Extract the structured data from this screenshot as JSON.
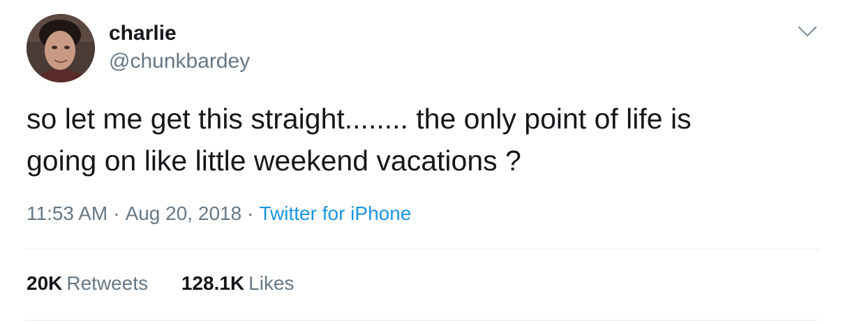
{
  "user": {
    "display_name": "charlie",
    "handle": "@chunkbardey"
  },
  "tweet": {
    "text_line1": "so let me get this straight........ the only point of life is",
    "text_line2": "going on like little weekend vacations ?",
    "time": "11:53 AM",
    "date": "Aug 20, 2018",
    "separator": "·",
    "source": "Twitter for iPhone"
  },
  "stats": {
    "retweets_count": "20K",
    "retweets_label": "Retweets",
    "likes_count": "128.1K",
    "likes_label": "Likes"
  },
  "icons": {
    "caret": "chevron-down-icon",
    "avatar": "avatar"
  },
  "colors": {
    "text": "#14171a",
    "secondary": "#657786",
    "link": "#1b95e0",
    "divider": "#e6ecf0"
  }
}
